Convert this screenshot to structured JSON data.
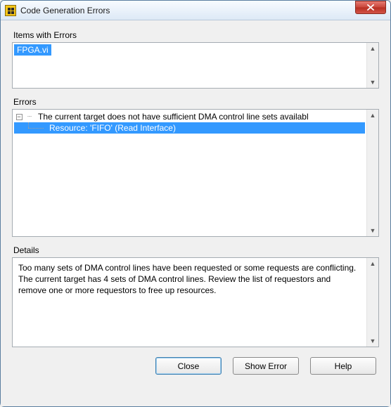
{
  "window": {
    "title": "Code Generation Errors"
  },
  "sections": {
    "items_label": "Items with Errors",
    "errors_label": "Errors",
    "details_label": "Details"
  },
  "items": {
    "selected": "FPGA.vi"
  },
  "errors": {
    "parent": "The current target does not have sufficient DMA control line sets availabl",
    "child": "Resource: 'FIFO' (Read Interface)",
    "expander_glyph": "−"
  },
  "details": {
    "text": "Too many sets of DMA control lines have been requested or some requests are conflicting. The current target has 4 sets of DMA control lines. Review the list of requestors and remove one or more requestors to free up resources."
  },
  "buttons": {
    "close": "Close",
    "show_error": "Show Error",
    "help": "Help"
  },
  "scroll": {
    "up": "▲",
    "down": "▼"
  }
}
